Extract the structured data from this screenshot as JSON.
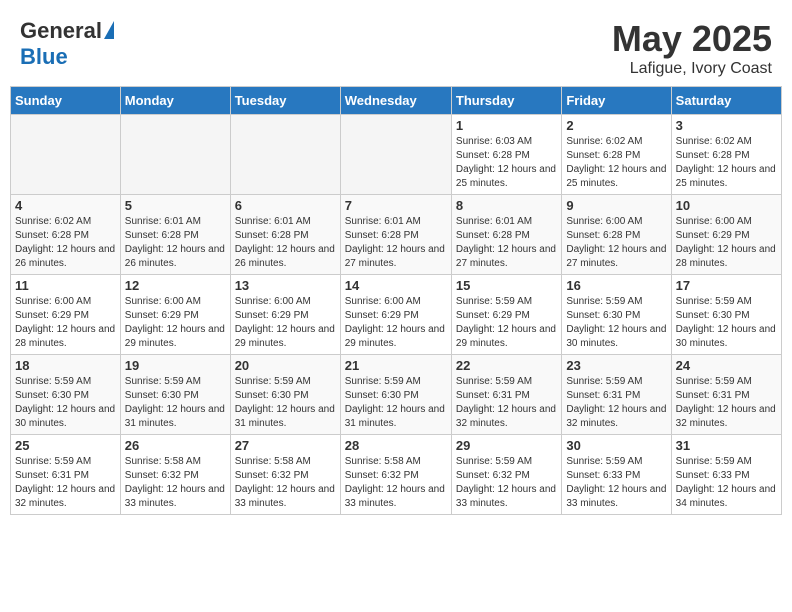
{
  "header": {
    "logo_general": "General",
    "logo_blue": "Blue",
    "month_title": "May 2025",
    "location": "Lafigue, Ivory Coast"
  },
  "days_of_week": [
    "Sunday",
    "Monday",
    "Tuesday",
    "Wednesday",
    "Thursday",
    "Friday",
    "Saturday"
  ],
  "weeks": [
    [
      {
        "day": "",
        "empty": true
      },
      {
        "day": "",
        "empty": true
      },
      {
        "day": "",
        "empty": true
      },
      {
        "day": "",
        "empty": true
      },
      {
        "day": "1",
        "sunrise": "6:03 AM",
        "sunset": "6:28 PM",
        "daylight": "12 hours and 25 minutes."
      },
      {
        "day": "2",
        "sunrise": "6:02 AM",
        "sunset": "6:28 PM",
        "daylight": "12 hours and 25 minutes."
      },
      {
        "day": "3",
        "sunrise": "6:02 AM",
        "sunset": "6:28 PM",
        "daylight": "12 hours and 25 minutes."
      }
    ],
    [
      {
        "day": "4",
        "sunrise": "6:02 AM",
        "sunset": "6:28 PM",
        "daylight": "12 hours and 26 minutes."
      },
      {
        "day": "5",
        "sunrise": "6:01 AM",
        "sunset": "6:28 PM",
        "daylight": "12 hours and 26 minutes."
      },
      {
        "day": "6",
        "sunrise": "6:01 AM",
        "sunset": "6:28 PM",
        "daylight": "12 hours and 26 minutes."
      },
      {
        "day": "7",
        "sunrise": "6:01 AM",
        "sunset": "6:28 PM",
        "daylight": "12 hours and 27 minutes."
      },
      {
        "day": "8",
        "sunrise": "6:01 AM",
        "sunset": "6:28 PM",
        "daylight": "12 hours and 27 minutes."
      },
      {
        "day": "9",
        "sunrise": "6:00 AM",
        "sunset": "6:28 PM",
        "daylight": "12 hours and 27 minutes."
      },
      {
        "day": "10",
        "sunrise": "6:00 AM",
        "sunset": "6:29 PM",
        "daylight": "12 hours and 28 minutes."
      }
    ],
    [
      {
        "day": "11",
        "sunrise": "6:00 AM",
        "sunset": "6:29 PM",
        "daylight": "12 hours and 28 minutes."
      },
      {
        "day": "12",
        "sunrise": "6:00 AM",
        "sunset": "6:29 PM",
        "daylight": "12 hours and 29 minutes."
      },
      {
        "day": "13",
        "sunrise": "6:00 AM",
        "sunset": "6:29 PM",
        "daylight": "12 hours and 29 minutes."
      },
      {
        "day": "14",
        "sunrise": "6:00 AM",
        "sunset": "6:29 PM",
        "daylight": "12 hours and 29 minutes."
      },
      {
        "day": "15",
        "sunrise": "5:59 AM",
        "sunset": "6:29 PM",
        "daylight": "12 hours and 29 minutes."
      },
      {
        "day": "16",
        "sunrise": "5:59 AM",
        "sunset": "6:30 PM",
        "daylight": "12 hours and 30 minutes."
      },
      {
        "day": "17",
        "sunrise": "5:59 AM",
        "sunset": "6:30 PM",
        "daylight": "12 hours and 30 minutes."
      }
    ],
    [
      {
        "day": "18",
        "sunrise": "5:59 AM",
        "sunset": "6:30 PM",
        "daylight": "12 hours and 30 minutes."
      },
      {
        "day": "19",
        "sunrise": "5:59 AM",
        "sunset": "6:30 PM",
        "daylight": "12 hours and 31 minutes."
      },
      {
        "day": "20",
        "sunrise": "5:59 AM",
        "sunset": "6:30 PM",
        "daylight": "12 hours and 31 minutes."
      },
      {
        "day": "21",
        "sunrise": "5:59 AM",
        "sunset": "6:30 PM",
        "daylight": "12 hours and 31 minutes."
      },
      {
        "day": "22",
        "sunrise": "5:59 AM",
        "sunset": "6:31 PM",
        "daylight": "12 hours and 32 minutes."
      },
      {
        "day": "23",
        "sunrise": "5:59 AM",
        "sunset": "6:31 PM",
        "daylight": "12 hours and 32 minutes."
      },
      {
        "day": "24",
        "sunrise": "5:59 AM",
        "sunset": "6:31 PM",
        "daylight": "12 hours and 32 minutes."
      }
    ],
    [
      {
        "day": "25",
        "sunrise": "5:59 AM",
        "sunset": "6:31 PM",
        "daylight": "12 hours and 32 minutes."
      },
      {
        "day": "26",
        "sunrise": "5:58 AM",
        "sunset": "6:32 PM",
        "daylight": "12 hours and 33 minutes."
      },
      {
        "day": "27",
        "sunrise": "5:58 AM",
        "sunset": "6:32 PM",
        "daylight": "12 hours and 33 minutes."
      },
      {
        "day": "28",
        "sunrise": "5:58 AM",
        "sunset": "6:32 PM",
        "daylight": "12 hours and 33 minutes."
      },
      {
        "day": "29",
        "sunrise": "5:59 AM",
        "sunset": "6:32 PM",
        "daylight": "12 hours and 33 minutes."
      },
      {
        "day": "30",
        "sunrise": "5:59 AM",
        "sunset": "6:33 PM",
        "daylight": "12 hours and 33 minutes."
      },
      {
        "day": "31",
        "sunrise": "5:59 AM",
        "sunset": "6:33 PM",
        "daylight": "12 hours and 34 minutes."
      }
    ]
  ]
}
